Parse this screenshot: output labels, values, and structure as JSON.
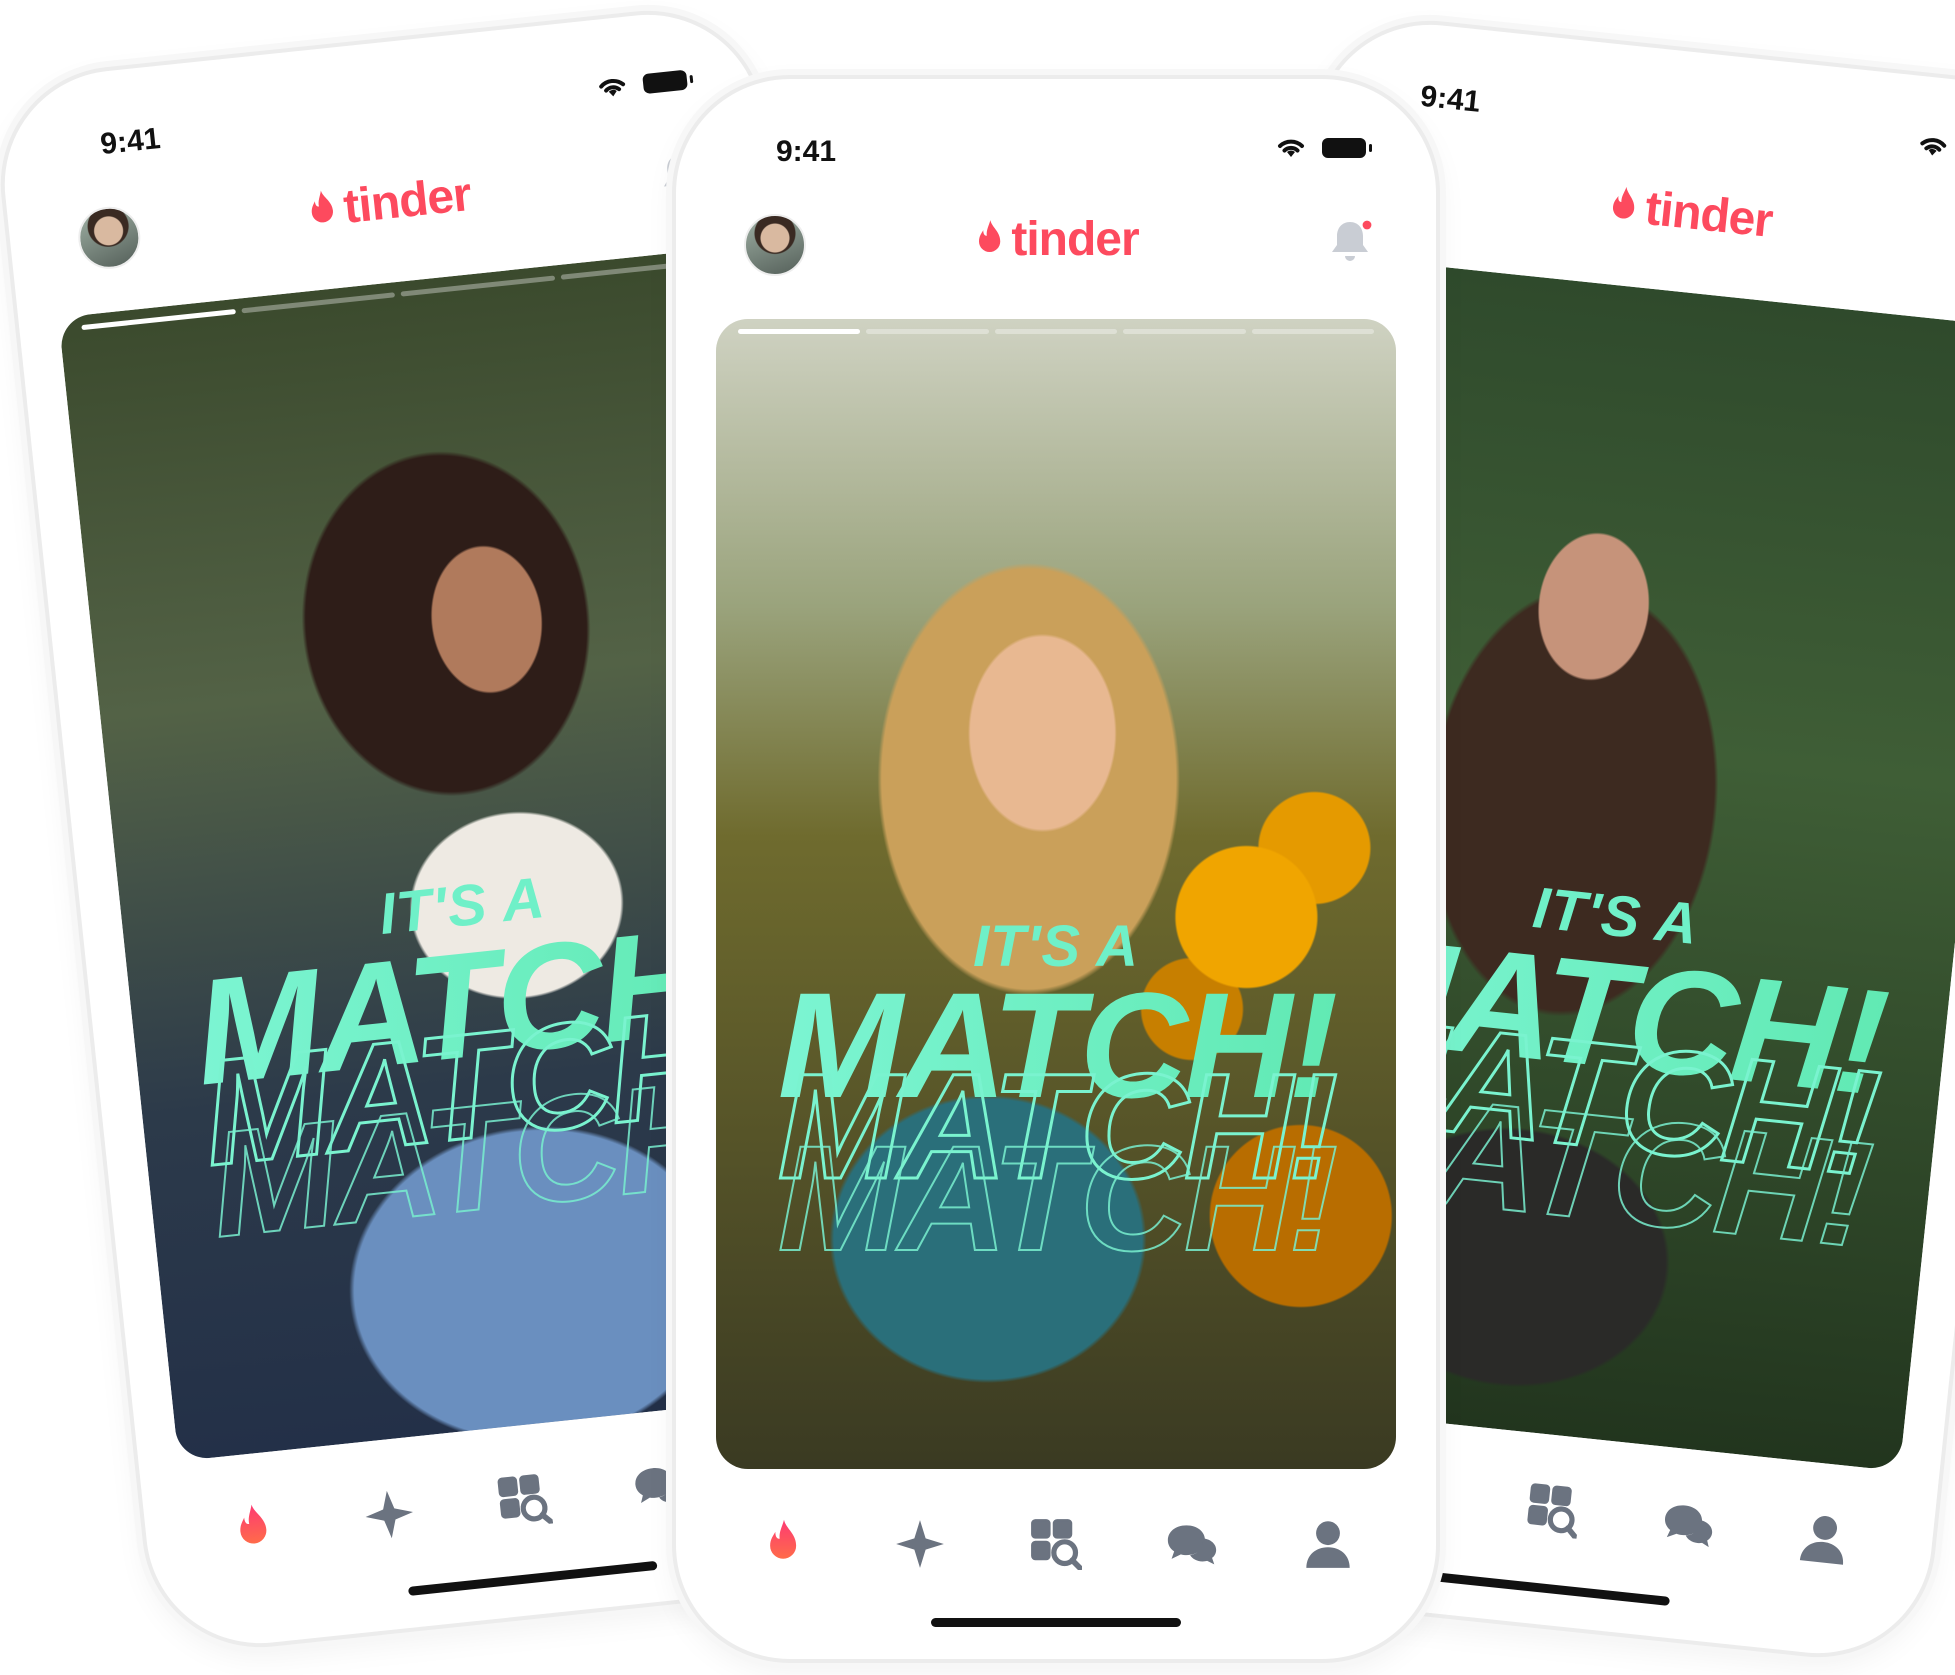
{
  "status": {
    "time": "9:41"
  },
  "app": {
    "logo_text": "tinder",
    "brand_color": "#fd4a5e"
  },
  "match": {
    "small": "IT'S A",
    "big": "MATCH!"
  },
  "tabs": [
    {
      "name": "flame-tab",
      "icon": "flame-icon"
    },
    {
      "name": "gold-tab",
      "icon": "sparkle-icon"
    },
    {
      "name": "explore-tab",
      "icon": "explore-icon"
    },
    {
      "name": "messages-tab",
      "icon": "chat-icon"
    },
    {
      "name": "profile-tab",
      "icon": "person-icon"
    }
  ],
  "colors": {
    "accent_green": "#6ff0c8",
    "icon_gray": "#6b7380"
  }
}
